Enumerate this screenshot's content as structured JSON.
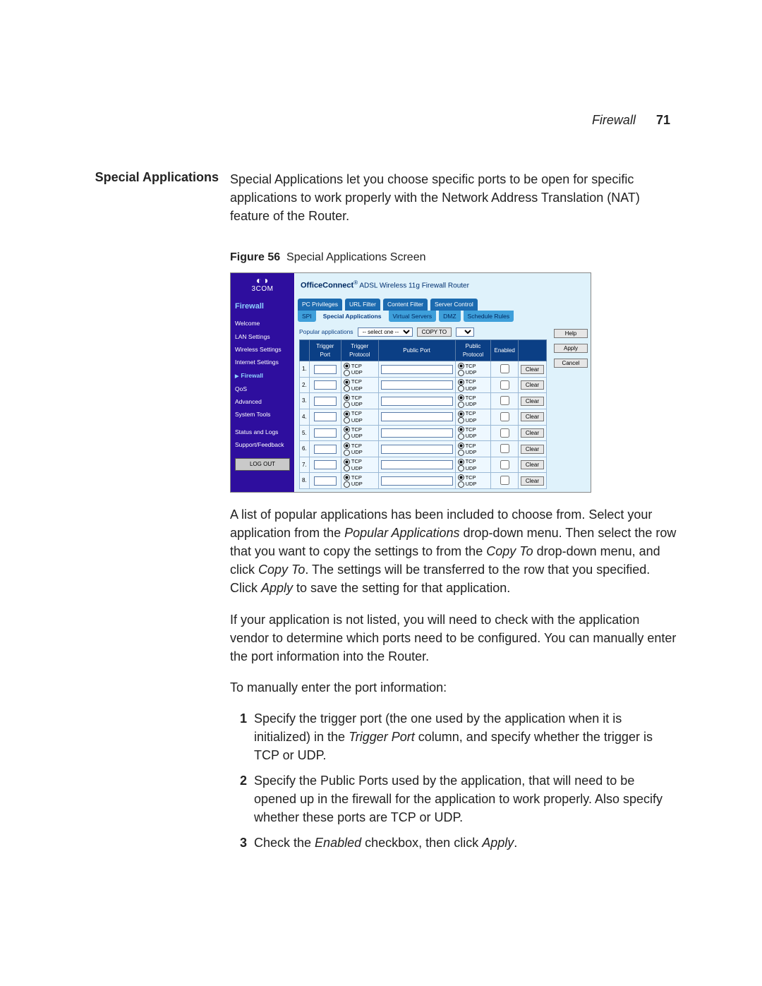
{
  "header": {
    "section": "Firewall",
    "page_number": "71"
  },
  "title": "Special Applications",
  "intro": "Special Applications let you choose specific ports to be open for specific applications to work properly with the Network Address Translation (NAT) feature of the Router.",
  "figure": {
    "label": "Figure 56",
    "caption": "Special Applications Screen"
  },
  "router": {
    "brand": "3COM",
    "product_prefix": "OfficeConnect",
    "product_suffix": "ADSL Wireless 11g Firewall Router",
    "section": "Firewall",
    "side_items": [
      "Welcome",
      "LAN Settings",
      "Wireless Settings",
      "Internet Settings",
      "Firewall",
      "QoS",
      "Advanced",
      "System Tools",
      "",
      "Status and Logs",
      "Support/Feedback"
    ],
    "side_active_index": 4,
    "logout": "LOG OUT",
    "tabs_top": [
      "PC Privileges",
      "URL Filter",
      "Content Filter",
      "Server Control"
    ],
    "tabs_bottom": [
      "SPI",
      "Special Applications",
      "Virtual Servers",
      "DMZ",
      "Schedule Rules"
    ],
    "tabs_bottom_active": 1,
    "popular_label": "Popular applications",
    "popular_placeholder": "-- select one --",
    "copyto_label": "COPY TO",
    "table": {
      "headers": [
        "",
        "Trigger Port",
        "Trigger Protocol",
        "Public Port",
        "Public Protocol",
        "Enabled",
        ""
      ],
      "proto_opts": [
        "TCP",
        "UDP"
      ],
      "clear": "Clear",
      "row_count": 8
    },
    "action_buttons": {
      "help": "Help",
      "apply": "Apply",
      "cancel": "Cancel"
    }
  },
  "after_figure_paras": [
    "A list of popular applications has been included to choose from. Select your application from the Popular Applications drop-down menu. Then select the row that you want to copy the settings to from the Copy To drop-down menu, and click Copy To. The settings will be transferred to the row that you specified. Click Apply to save the setting for that application.",
    "If your application is not listed, you will need to check with the application vendor to determine which ports need to be configured. You can manually enter the port information into the Router.",
    "To manually enter the port information:"
  ],
  "steps": [
    "Specify the trigger port (the one used by the application when it is initialized) in the Trigger Port column, and specify whether the trigger is TCP or UDP.",
    "Specify the Public Ports used by the application, that will need to be opened up in the firewall for the application to work properly. Also specify whether these ports are TCP or UDP.",
    "Check the Enabled checkbox, then click Apply."
  ]
}
